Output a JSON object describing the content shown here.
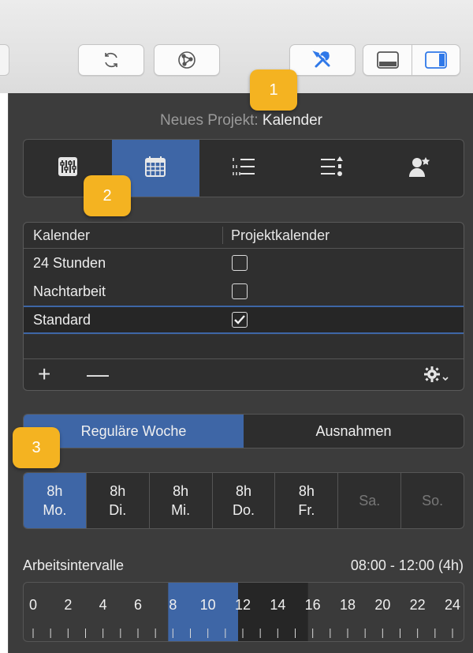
{
  "toolbar": {
    "buttons": [
      "refresh-icon",
      "network-icon",
      "tools-icon",
      "bottom-panel-icon",
      "right-panel-icon"
    ]
  },
  "inspector": {
    "title_prefix": "Neues Projekt:",
    "title_value": "Kalender",
    "segments": [
      "sliders-icon",
      "calendar-icon",
      "list-icon",
      "sort-list-icon",
      "resource-icon"
    ],
    "active_segment": 1
  },
  "calendar_table": {
    "col_name": "Kalender",
    "col_project": "Projektkalender",
    "rows": [
      {
        "name": "24 Stunden",
        "checked": false
      },
      {
        "name": "Nachtarbeit",
        "checked": false
      },
      {
        "name": "Standard",
        "checked": true
      }
    ],
    "add_label": "+",
    "remove_label": "—"
  },
  "week_tabs": {
    "regular": "Reguläre Woche",
    "exceptions": "Ausnahmen"
  },
  "days": [
    {
      "hours": "8h",
      "label": "Mo."
    },
    {
      "hours": "8h",
      "label": "Di."
    },
    {
      "hours": "8h",
      "label": "Mi."
    },
    {
      "hours": "8h",
      "label": "Do."
    },
    {
      "hours": "8h",
      "label": "Fr."
    },
    {
      "hours": "",
      "label": "Sa."
    },
    {
      "hours": "",
      "label": "So."
    }
  ],
  "intervals": {
    "label": "Arbeitsintervalle",
    "value": "08:00 - 12:00 (4h)",
    "ticks": [
      "0",
      "2",
      "4",
      "6",
      "8",
      "10",
      "12",
      "14",
      "16",
      "18",
      "20",
      "22",
      "24"
    ],
    "selected_range": [
      8,
      12
    ],
    "secondary_range": [
      12,
      16
    ]
  },
  "badges": [
    "1",
    "2",
    "3"
  ],
  "colors": {
    "accent": "#3e66a6",
    "badge": "#f4b321",
    "panel": "#3c3c3c"
  }
}
